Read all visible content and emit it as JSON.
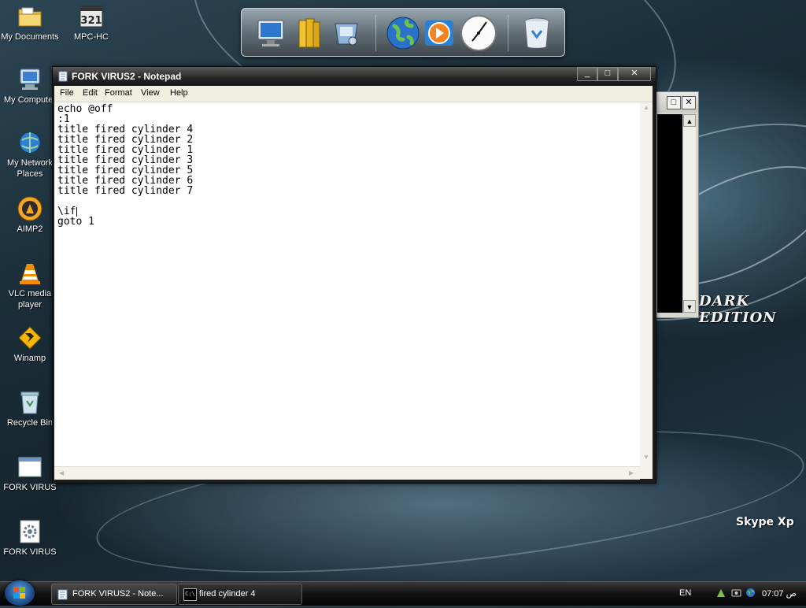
{
  "desktop": {
    "icons": [
      {
        "label": "My Documents",
        "icon": "folder-documents-icon"
      },
      {
        "label": "MPC-HC",
        "icon": "media-player-classic-icon"
      },
      {
        "label": "My Computer",
        "icon": "computer-icon"
      },
      {
        "label": "My Network Places",
        "icon": "network-icon"
      },
      {
        "label": "AIMP2",
        "icon": "aimp-icon"
      },
      {
        "label": "VLC media player",
        "icon": "vlc-cone-icon"
      },
      {
        "label": "Winamp",
        "icon": "winamp-icon"
      },
      {
        "label": "Recycle Bin",
        "icon": "recycle-bin-icon"
      },
      {
        "label": "FORK VIRUS",
        "icon": "window-file-icon"
      },
      {
        "label": "FORK VIRUS",
        "icon": "settings-file-icon"
      }
    ],
    "wallpaper_text_1": "DARK EDITION",
    "wallpaper_text_2": "Skype Xp"
  },
  "dock": {
    "items": [
      {
        "name": "monitor",
        "icon": "monitor-icon"
      },
      {
        "name": "folders",
        "icon": "folders-icon"
      },
      {
        "name": "control-panel",
        "icon": "control-panel-icon"
      },
      {
        "name": "globe",
        "icon": "globe-icon"
      },
      {
        "name": "media-player",
        "icon": "media-play-icon"
      },
      {
        "name": "clock",
        "icon": "clock-icon"
      },
      {
        "name": "trash",
        "icon": "trash-icon"
      }
    ]
  },
  "notepad": {
    "title": "FORK VIRUS2 - Notepad",
    "menu": [
      "File",
      "Edit",
      "Format",
      "View",
      "Help"
    ],
    "lines": [
      "echo @off",
      ":1",
      "title fired cylinder 4",
      "title fired cylinder 2",
      "title fired cylinder 1",
      "title fired cylinder 3",
      "title fired cylinder 5",
      "title fired cylinder 6",
      "title fired cylinder 7",
      "",
      "\\if",
      "goto 1"
    ],
    "buttons": {
      "minimize": "_",
      "maximize": "□",
      "close": "✕"
    }
  },
  "console": {
    "buttons": {
      "maximize": "□",
      "close": "✕"
    }
  },
  "taskbar": {
    "tasks": [
      {
        "label": "FORK VIRUS2 - Note...",
        "icon": "notepad-icon"
      },
      {
        "label": "fired cylinder 4",
        "icon": "console-icon",
        "icon_text": "C:\\"
      }
    ],
    "language": "EN",
    "clock": "07:07 ص",
    "accent": "#1f4f8c"
  }
}
